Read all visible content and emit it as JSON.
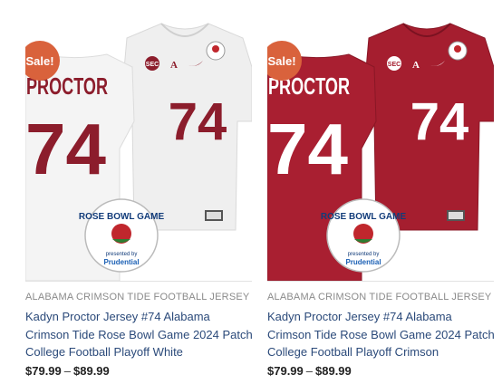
{
  "products": [
    {
      "badge": "Sale!",
      "category": "ALABAMA CRIMSON TIDE FOOTBALL JERSEY",
      "title": "Kadyn Proctor Jersey #74 Alabama Crimson Tide Rose Bowl Game 2024 Patch College Football Playoff White",
      "price_min": "$79.99",
      "price_sep": "–",
      "price_max": "$89.99",
      "jersey_name": "PROCTOR",
      "jersey_number": "74",
      "jersey_number_front": "74",
      "patch_line1": "ROSE BOWL GAME",
      "patch_line2": "presented by",
      "patch_line3": "Prudential",
      "colors": {
        "jersey": "#f1f1f1",
        "numbers": "#8c1d2c"
      }
    },
    {
      "badge": "Sale!",
      "category": "ALABAMA CRIMSON TIDE FOOTBALL JERSEY",
      "title": "Kadyn Proctor Jersey #74 Alabama Crimson Tide Rose Bowl Game 2024 Patch College Football Playoff Crimson",
      "price_min": "$79.99",
      "price_sep": "–",
      "price_max": "$89.99",
      "jersey_name": "PROCTOR",
      "jersey_number": "74",
      "jersey_number_front": "74",
      "patch_line1": "ROSE BOWL GAME",
      "patch_line2": "presented by",
      "patch_line3": "Prudential",
      "colors": {
        "jersey": "#a51e2f",
        "numbers": "#ffffff"
      }
    }
  ]
}
